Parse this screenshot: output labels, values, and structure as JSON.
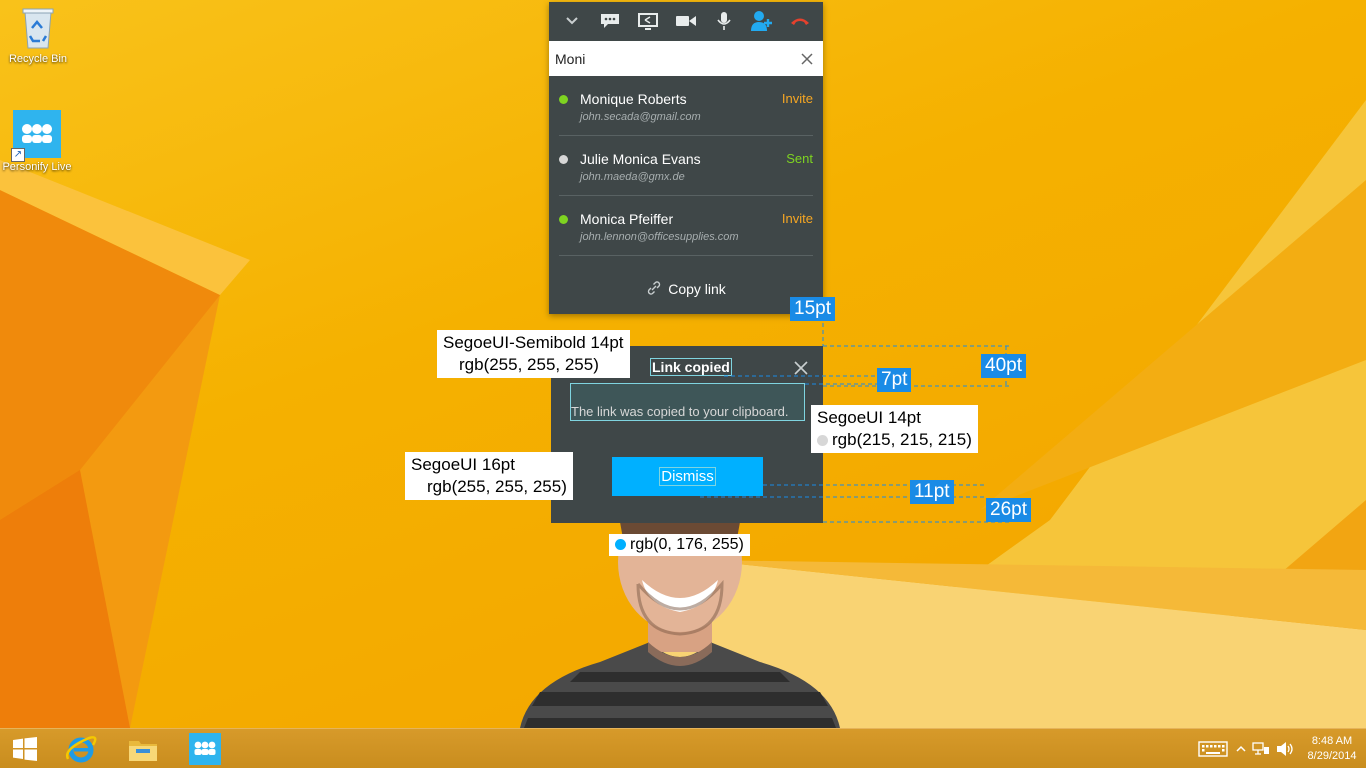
{
  "desktop": {
    "icons": [
      {
        "label": "Recycle Bin",
        "icon": "recycle-bin-icon"
      },
      {
        "label": "Personify Live",
        "icon": "personify-live-icon"
      }
    ]
  },
  "call_panel": {
    "toolbar": [
      "collapse-chevron-icon",
      "chat-icon",
      "screen-share-icon",
      "video-camera-icon",
      "microphone-icon",
      "add-participant-icon",
      "hang-up-icon"
    ],
    "search": {
      "value": "Moni"
    },
    "contacts": [
      {
        "name": "Monique Roberts",
        "email": "john.secada@gmail.com",
        "status": "online",
        "action": "Invite"
      },
      {
        "name": "Julie Monica Evans",
        "email": "john.maeda@gmx.de",
        "status": "offline",
        "action": "Sent"
      },
      {
        "name": "Monica Pfeiffer",
        "email": "john.lennon@officesupplies.com",
        "status": "online",
        "action": "Invite"
      }
    ],
    "copy_link": "Copy link"
  },
  "dialog": {
    "title": "Link copied",
    "message": "The link was copied to your clipboard.",
    "button": "Dismiss"
  },
  "annotations": {
    "title_font": {
      "line1": "SegoeUI-Semibold 14pt",
      "line2": "rgb(255, 255, 255)"
    },
    "message_font": {
      "line1": "SegoeUI 14pt",
      "line2": "rgb(215, 215, 215)"
    },
    "button_font": {
      "line1": "SegoeUI 16pt",
      "line2": "rgb(255, 255, 255)"
    },
    "button_color": "rgb(0, 176, 255)",
    "measurements": [
      "15pt",
      "40pt",
      "7pt",
      "11pt",
      "26pt"
    ]
  },
  "taskbar": {
    "apps": [
      "windows-start-icon",
      "internet-explorer-icon",
      "file-explorer-icon",
      "personify-live-icon"
    ],
    "tray": [
      "keyboard-icon",
      "show-hidden-icons-chevron",
      "network-icon",
      "volume-icon"
    ],
    "time": "8:48 AM",
    "date": "8/29/2014"
  },
  "colors": {
    "panel_bg": "#3f4748",
    "accent": "#00b0ff",
    "invite": "#f6a623",
    "sent": "#7ed321",
    "online": "#7ed321",
    "offline": "#d7d7d7",
    "measure_bg": "#1a8be6"
  }
}
